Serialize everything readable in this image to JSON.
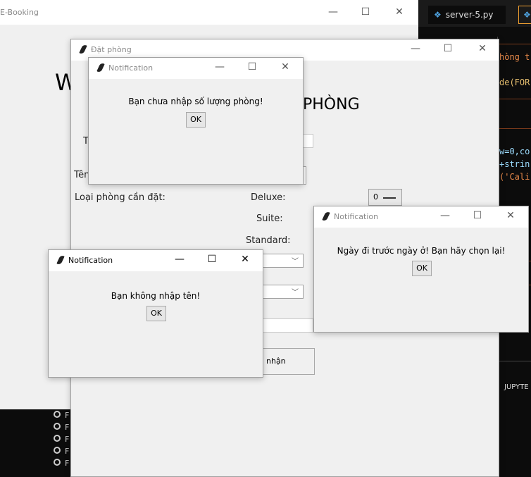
{
  "ebooking": {
    "title": "E-Booking",
    "big_w": "W",
    "phong": "PHÒNG",
    "list_items": [
      "F",
      "F",
      "F",
      "F",
      "F"
    ]
  },
  "controls": {
    "minimize": "—",
    "maximize": "☐",
    "close": "✕"
  },
  "editor": {
    "tab1": "server-5.py",
    "tab2": "",
    "lines": [
      "hòng t",
      "de(FOR",
      "w=0,co",
      "+strin",
      "('Cali"
    ],
    "jupyter": "JUPYTE"
  },
  "dat_phong": {
    "title": "Đặt phòng",
    "label_t": "T",
    "label_ten": "Tên",
    "loai_phong": "Loại phòng cần đặt:",
    "deluxe": "Deluxe:",
    "suite": "Suite:",
    "standard": "Standard:",
    "deluxe_value": "0",
    "confirm_button": "nhận"
  },
  "notif_top": {
    "title": "Notification",
    "message": "Bạn chưa nhập số lượng phòng!",
    "ok": "OK"
  },
  "notif_left": {
    "title": "Notification",
    "message": "Bạn không nhập tên!",
    "ok": "OK"
  },
  "notif_right": {
    "title": "Notification",
    "message": "Ngày đi trước ngày ở! Bạn hãy chọn lại!",
    "ok": "OK"
  },
  "colors": {
    "editor_bg": "#0c0c0c",
    "code_orange": "#e8894a",
    "code_blue": "#9cdcfe",
    "tab_active": "#f0a030"
  }
}
